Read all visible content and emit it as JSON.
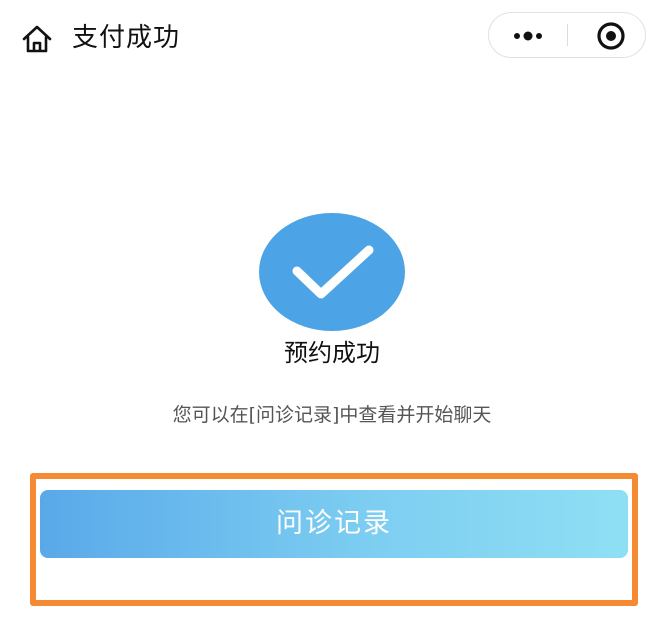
{
  "nav": {
    "title": "支付成功",
    "home_icon": "home-outline-icon",
    "more_icon": "more-dots-icon",
    "close_icon": "target-circle-icon"
  },
  "result": {
    "status_icon": "check-circle-icon",
    "title": "预约成功",
    "description": "您可以在[问诊记录]中查看并开始聊天"
  },
  "actions": {
    "records_label": "问诊记录",
    "highlight_color": "#f58a33"
  },
  "colors": {
    "accent": "#4ca3e5",
    "button_gradient_start": "#59a9ea",
    "button_gradient_end": "#8fdff4"
  }
}
